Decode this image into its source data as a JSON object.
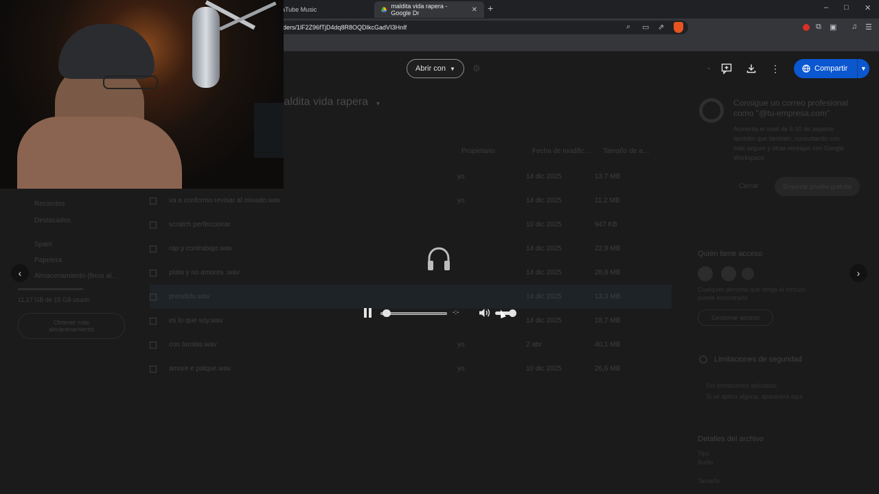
{
  "browser": {
    "tabs": [
      {
        "label": "aTube Music",
        "active": false
      },
      {
        "label": "maldita vida rapera - Google Dr",
        "active": true
      }
    ],
    "new_tab": "+",
    "window_controls": [
      "–",
      "□",
      "✕"
    ],
    "address": "ders/1lF2Z96fTjD4dq8R8OQDIkcGadVI3HnIf"
  },
  "drive": {
    "title": "maldita vida rapera",
    "columns": {
      "owner": "Propietario",
      "modified": "Fecha de modific…",
      "size": "Tamaño de a…"
    },
    "files": [
      {
        "name": "",
        "owner": "yo",
        "date": "14 dic 2025",
        "size": "13,7 MB"
      },
      {
        "name": "va a conformo revisar al mixado.wav",
        "owner": "yo",
        "date": "14 dic 2025",
        "size": "11,2 MB"
      },
      {
        "name": "scratch perfeccionar",
        "owner": "",
        "date": "10 dic 2025",
        "size": "947 KB"
      },
      {
        "name": "rap y contrabajo.wav",
        "owner": "",
        "date": "14 dic 2025",
        "size": "22,9 MB"
      },
      {
        "name": "plata y no amores .wav",
        "owner": "",
        "date": "14 dic 2025",
        "size": "28,8 MB"
      },
      {
        "name": "prendido.wav",
        "owner": "",
        "date": "14 dic 2025",
        "size": "13,3 MB"
      },
      {
        "name": "es lo que soy.wav",
        "owner": "",
        "date": "14 dic 2025",
        "size": "18,7 MB"
      },
      {
        "name": "con tarolas.wav",
        "owner": "yo",
        "date": "2 abr",
        "size": "40,1 MB"
      },
      {
        "name": "amore e palque.wav",
        "owner": "yo",
        "date": "10 dic 2025",
        "size": "26,6 MB"
      }
    ],
    "sidebar": [
      "Recientes",
      "Destacados",
      "Spam",
      "Papelera",
      "Almacenamiento (lleno al…"
    ],
    "storage_text": "11,17 GB de 15 GB usado",
    "storage_button": "Obtener más almacenamiento",
    "right_panel": {
      "promo_title": "Consigue un correo profesional como \"@tu-empresa.com\"",
      "promo_body": "Aumenta el nivel de 6-10 de aspecto también que también, consultando con más seguro y otras ventajas con Google Workspace",
      "promo_cancel": "Cerrar",
      "promo_cta": "Empezar prueba gratuita",
      "access_title": "Quién tiene acceso",
      "access_text": "Cualquier persona que tenga el vínculo puede encontrarlo",
      "access_button": "Gestionar acceso",
      "security_title": "Limitaciones de seguridad",
      "security_line1": "Sin limitaciones aplicadas",
      "security_line2": "Si se aplica alguna, aparecerá aquí",
      "details_title": "Detalles del archivo",
      "type_label": "Tipo",
      "type_value": "Audio",
      "size_label": "Tamaño"
    }
  },
  "viewer": {
    "open_with_label": "Abrir con",
    "share_label": "Compartir",
    "prev_label": "‹",
    "next_label": "›"
  },
  "player": {
    "progress": 0.02,
    "time_display": "-:-",
    "volume": 0.85
  },
  "colors": {
    "share_bg": "#0b57d0",
    "background": "#1b1b1b"
  }
}
